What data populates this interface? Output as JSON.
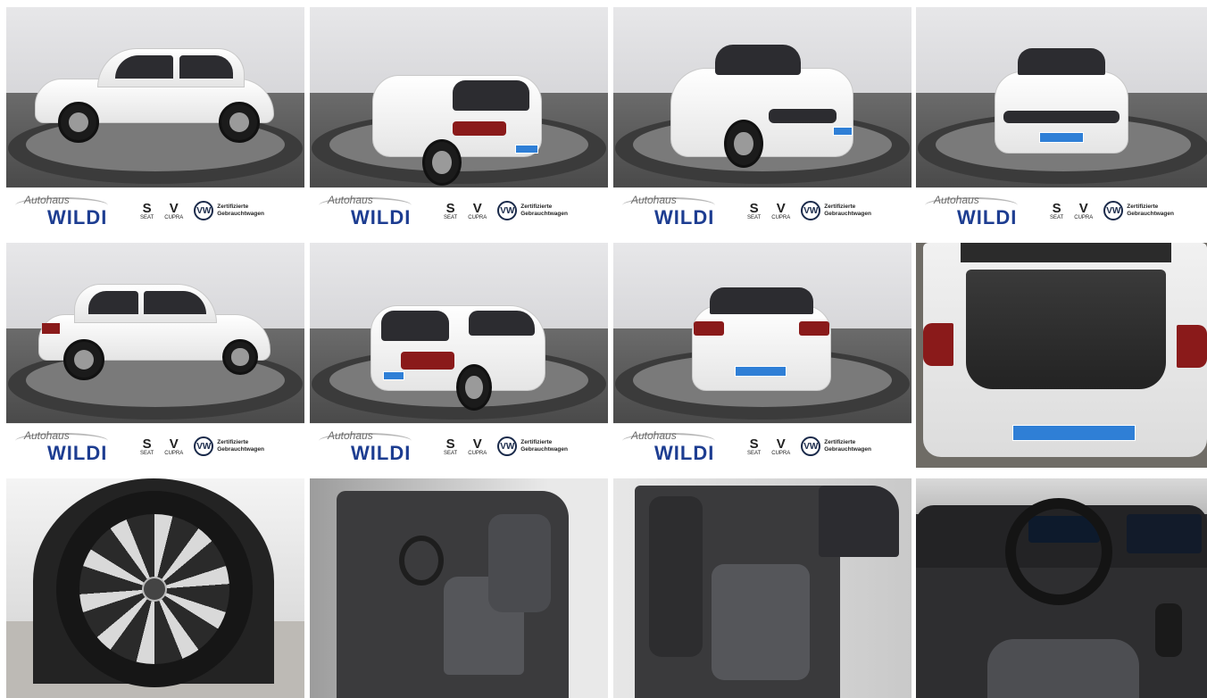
{
  "dealer": {
    "logo_small": "Autohaus",
    "logo_big": "WILDI",
    "brands": [
      {
        "glyph": "S",
        "label": "SEAT"
      },
      {
        "glyph": "V",
        "label": "CUPRA"
      }
    ],
    "vw_mark": "VW",
    "vw_text_line1": "Zertifizierte",
    "vw_text_line2": "Gebrauchtwagen"
  },
  "colors": {
    "car_body": "#ffffff",
    "dealer_blue": "#1d3d91",
    "plate_blue": "#2f7fd6"
  },
  "gallery": [
    {
      "view": "side-left"
    },
    {
      "view": "rear-three-quarter-left"
    },
    {
      "view": "front-three-quarter-right"
    },
    {
      "view": "front"
    },
    {
      "view": "side-right"
    },
    {
      "view": "rear-three-quarter-right"
    },
    {
      "view": "rear"
    },
    {
      "view": "trunk-open"
    },
    {
      "view": "wheel-closeup"
    },
    {
      "view": "front-seats"
    },
    {
      "view": "rear-seats"
    },
    {
      "view": "cockpit"
    }
  ]
}
